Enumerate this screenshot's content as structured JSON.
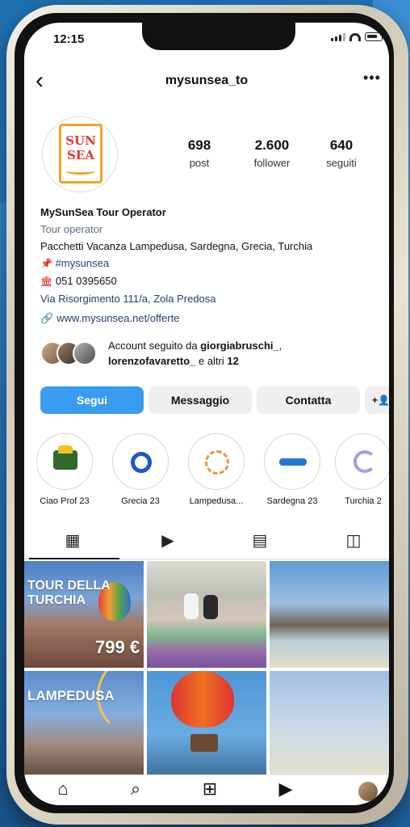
{
  "status_bar": {
    "time": "12:15"
  },
  "header": {
    "username": "mysunsea_to"
  },
  "profile": {
    "logo_line1": "SUN",
    "logo_line2": "SEA",
    "stats": [
      {
        "value": "698",
        "label": "post"
      },
      {
        "value": "2.600",
        "label": "follower"
      },
      {
        "value": "640",
        "label": "seguiti"
      }
    ],
    "name": "MySunSea Tour Operator",
    "category": "Tour operator",
    "description": "Pacchetti Vacanza Lampedusa, Sardegna, Grecia,  Turchia",
    "hashtag": "#mysunsea",
    "phone": "051 0395650",
    "address": "Via Risorgimento 111/a, Zola Predosa",
    "website": "www.mysunsea.net/offerte",
    "followed_by_prefix": "Account seguito da ",
    "followed_by_user1": "giorgiabruschi_",
    "followed_by_sep": ",",
    "followed_by_user2": "lorenzofavaretto_",
    "followed_by_and": " e altri ",
    "followed_by_count": "12"
  },
  "actions": {
    "follow": "Segui",
    "message": "Messaggio",
    "contact": "Contatta"
  },
  "highlights": [
    {
      "label": "Ciao Prof 23"
    },
    {
      "label": "Grecia 23"
    },
    {
      "label": "Lampedusa..."
    },
    {
      "label": "Sardegna 23"
    },
    {
      "label": "Turchia 2"
    }
  ],
  "posts": {
    "post1_title1": "TOUR DELLA",
    "post1_title2": "TURCHIA",
    "post1_price": "799 €",
    "post4_title": "LAMPEDUSA"
  },
  "colors": {
    "follow_button": "#3a9cf1",
    "link": "#25406e",
    "logo_orange": "#f0a32a",
    "logo_red": "#e23b2d"
  }
}
